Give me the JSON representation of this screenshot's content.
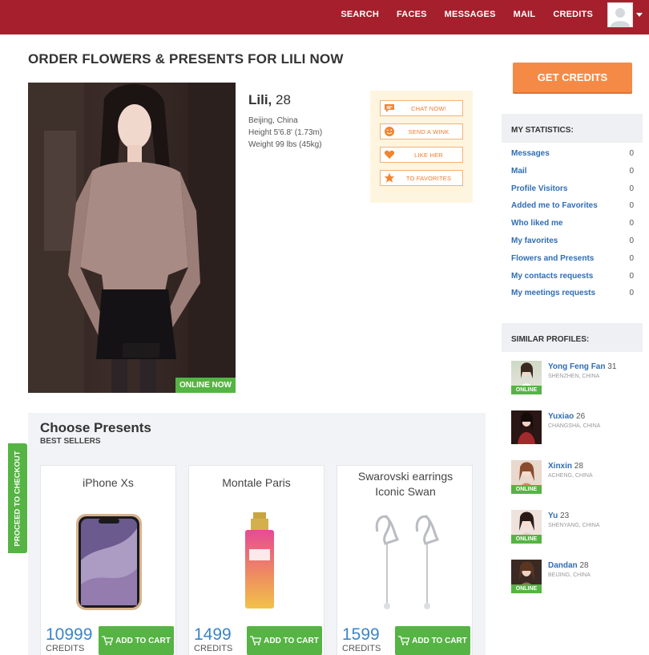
{
  "nav": {
    "items": [
      "SEARCH",
      "FACES",
      "MESSAGES",
      "MAIL",
      "CREDITS"
    ]
  },
  "page": {
    "title": "ORDER FLOWERS & PRESENTS FOR LILI NOW"
  },
  "profile": {
    "name": "Lili,",
    "age": "28",
    "location": "Beijing, China",
    "height": "Height 5'6.8' (1.73m)",
    "weight": "Weight 99 lbs (45kg)",
    "online_badge": "ONLINE NOW"
  },
  "actions": {
    "chat": "CHAT NOW!",
    "wink": "SEND A WINK",
    "like": "LIKE HER",
    "favorites": "TO FAVORITES"
  },
  "presents": {
    "title": "Choose Presents",
    "subtitle": "BEST SELLERS",
    "credits_label": "CREDITS",
    "add_label": "ADD TO CART",
    "items": [
      {
        "name": "iPhone Xs",
        "price": "10999"
      },
      {
        "name": "Montale Paris",
        "price": "1499"
      },
      {
        "name": "Swarovski earrings Iconic Swan",
        "price": "1599"
      }
    ]
  },
  "checkout": {
    "label": "PROCEED TO CHECKOUT"
  },
  "sidebar": {
    "get_credits": "GET CREDITS",
    "stats_title": "MY STATISTICS:",
    "stats": [
      {
        "label": "Messages",
        "value": "0"
      },
      {
        "label": "Mail",
        "value": "0"
      },
      {
        "label": "Profile Visitors",
        "value": "0"
      },
      {
        "label": "Added me to Favorites",
        "value": "0"
      },
      {
        "label": "Who liked me",
        "value": "0"
      },
      {
        "label": "My favorites",
        "value": "0"
      },
      {
        "label": "Flowers and Presents",
        "value": "0"
      },
      {
        "label": "My contacts requests",
        "value": "0"
      },
      {
        "label": "My meetings requests",
        "value": "0"
      }
    ],
    "similar_title": "SIMILAR PROFILES:",
    "similar": [
      {
        "name": "Yong Feng Fan",
        "age": "31",
        "location": "SHENZHEN, CHINA",
        "online": "ONLINE"
      },
      {
        "name": "Yuxiao",
        "age": "26",
        "location": "CHANGSHA, CHINA",
        "online": ""
      },
      {
        "name": "Xinxin",
        "age": "28",
        "location": "ACHENG, CHINA",
        "online": "ONLINE"
      },
      {
        "name": "Yu",
        "age": "23",
        "location": "SHENYANG, CHINA",
        "online": "ONLINE"
      },
      {
        "name": "Dandan",
        "age": "28",
        "location": "BEIJING, CHINA",
        "online": "ONLINE"
      }
    ]
  },
  "colors": {
    "topbar": "#a5202c",
    "link": "#2f6db5",
    "green": "#55b443",
    "orange": "#f58a47",
    "price": "#3a85c7"
  }
}
